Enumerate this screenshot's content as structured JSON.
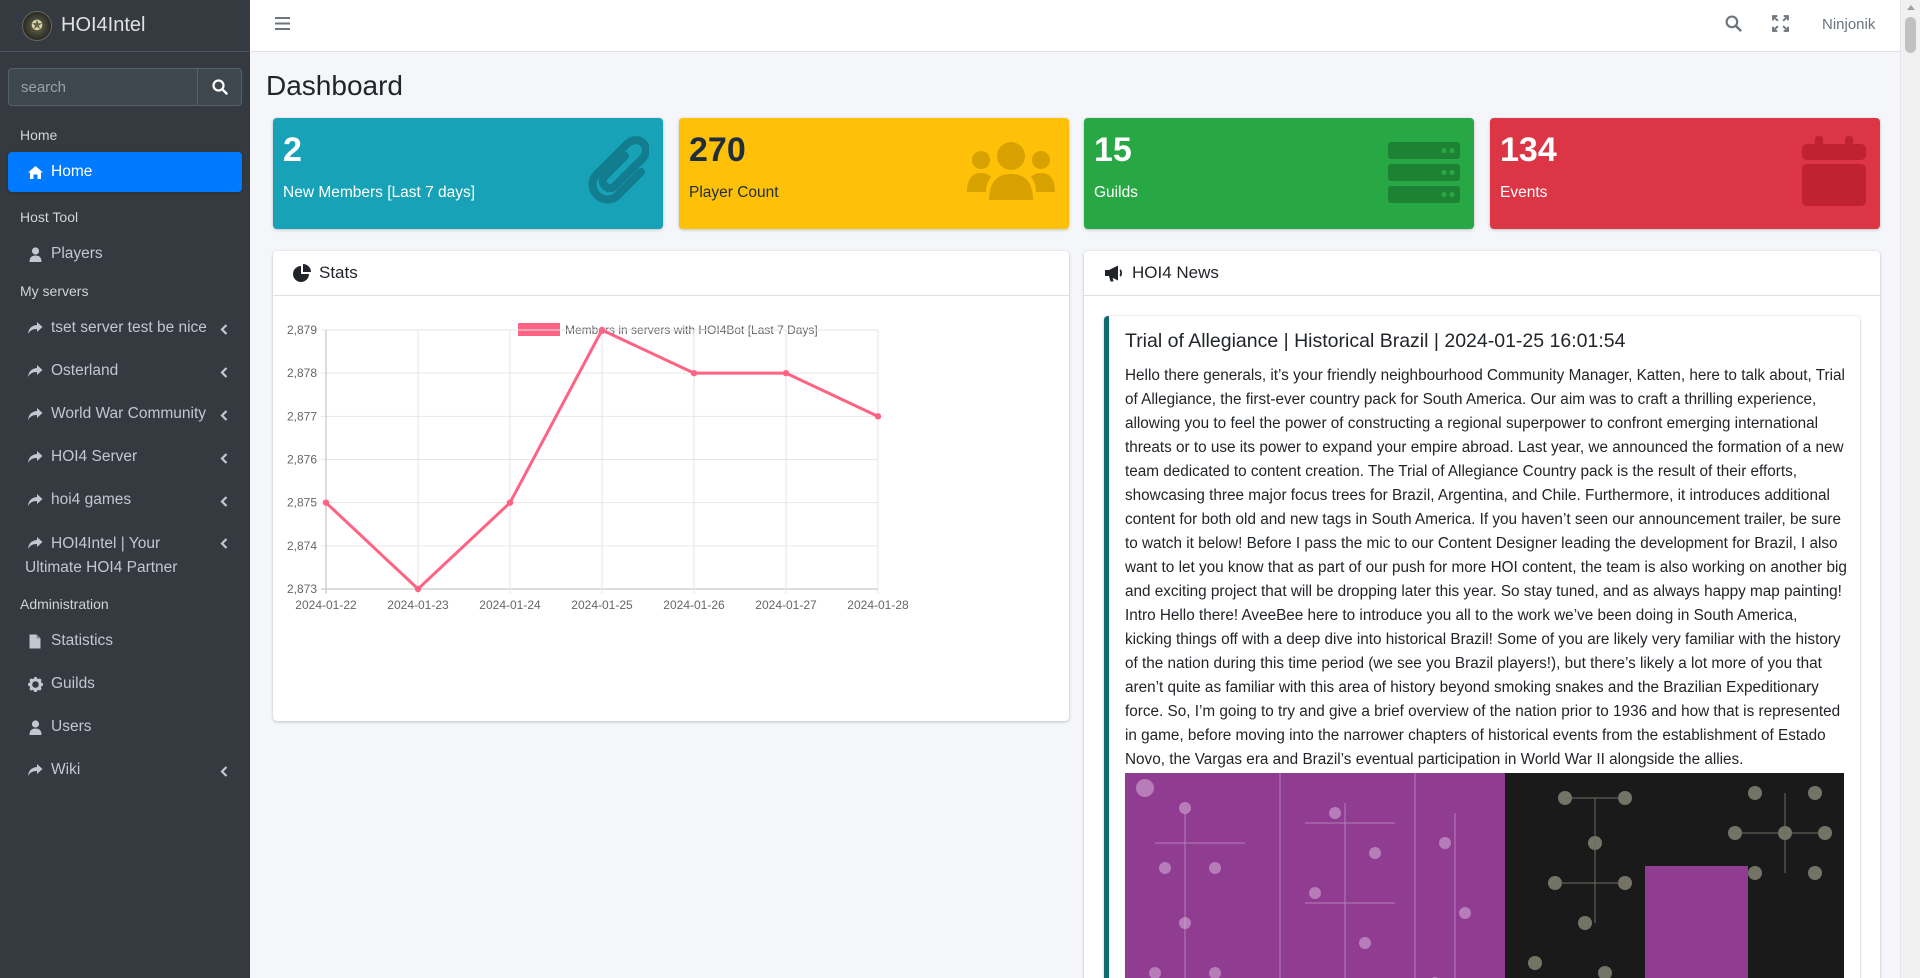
{
  "brand": {
    "name": "HOI4Intel"
  },
  "search": {
    "placeholder": "search"
  },
  "sidebar": {
    "sections": [
      {
        "header": "Home",
        "items": [
          {
            "label": "Home",
            "icon": "home-icon",
            "active": true,
            "expandable": false
          }
        ]
      },
      {
        "header": "Host Tool",
        "items": [
          {
            "label": "Players",
            "icon": "user-icon",
            "active": false,
            "expandable": false
          }
        ]
      },
      {
        "header": "My servers",
        "items": [
          {
            "label": "tset server test be nice",
            "icon": "share-icon",
            "expandable": true
          },
          {
            "label": "Osterland",
            "icon": "share-icon",
            "expandable": true
          },
          {
            "label": "World War Community",
            "icon": "share-icon",
            "expandable": true
          },
          {
            "label": "HOI4 Server",
            "icon": "share-icon",
            "expandable": true
          },
          {
            "label": "hoi4 games",
            "icon": "share-icon",
            "expandable": true
          },
          {
            "label": "HOI4Intel | Your Ultimate HOI4 Partner",
            "icon": "share-icon",
            "expandable": true
          }
        ]
      },
      {
        "header": "Administration",
        "items": [
          {
            "label": "Statistics",
            "icon": "file-icon",
            "expandable": false
          },
          {
            "label": "Guilds",
            "icon": "gear-icon",
            "expandable": false
          },
          {
            "label": "Users",
            "icon": "user-icon",
            "expandable": false
          },
          {
            "label": "Wiki",
            "icon": "share-icon",
            "expandable": true
          }
        ]
      }
    ]
  },
  "topbar": {
    "username": "Ninjonik"
  },
  "page": {
    "title": "Dashboard"
  },
  "info_boxes": [
    {
      "value": "2",
      "label": "New Members [Last 7 days]",
      "color": "#17a2b8",
      "icon": "paperclip-icon"
    },
    {
      "value": "270",
      "label": "Player Count",
      "color": "#ffc107",
      "icon": "users-icon"
    },
    {
      "value": "15",
      "label": "Guilds",
      "color": "#28a745",
      "icon": "server-icon"
    },
    {
      "value": "134",
      "label": "Events",
      "color": "#dc3545",
      "icon": "calendar-icon"
    }
  ],
  "stats_card": {
    "title": "Stats"
  },
  "news_card": {
    "title": "HOI4 News",
    "item": {
      "title": "Trial of Allegiance | Historical Brazil | 2024-01-25 16:01:54",
      "body": "Hello there generals, it’s your friendly neighbourhood Community Manager, Katten, here to talk about, Trial of Allegiance, the first-ever country pack for South America. Our aim was to craft a thrilling experience, allowing you to feel the power of constructing a regional superpower to confront emerging international threats or to use its power to expand your empire abroad. Last year, we announced the formation of a new team dedicated to content creation. The Trial of Allegiance Country pack is the result of their efforts, showcasing three major focus trees for Brazil, Argentina, and Chile. Furthermore, it introduces additional content for both old and new tags in South America. If you haven’t seen our announcement trailer, be sure to watch it below! Before I pass the mic to our Content Designer leading the development for Brazil, I also want to let you know that as part of our push for more HOI content, the team is also working on another big and exciting project that will be dropping later this year. So stay tuned, and as always happy map painting! Intro Hello there! AveeBee here to introduce you all to the work we’ve been doing in South America, kicking things off with a deep dive into historical Brazil! Some of you are likely very familiar with the history of the nation during this time period (we see you Brazil players!), but there’s likely a lot more of you that aren’t quite as familiar with this area of history beyond smoking snakes and the Brazilian Expeditionary force. So, I’m going to try and give a brief overview of the nation prior to 1936 and how that is represented in game, before moving into the narrower chapters of historical events from the establishment of Estado Novo, the Vargas era and Brazil’s eventual participation in World War II alongside the allies."
    }
  },
  "chart_data": {
    "type": "line",
    "legend": "Members in servers with HOI4Bot [Last 7 Days]",
    "color": "#ff6384",
    "x": [
      "2024-01-22",
      "2024-01-23",
      "2024-01-24",
      "2024-01-25",
      "2024-01-26",
      "2024-01-27",
      "2024-01-28"
    ],
    "values": [
      2875,
      2873,
      2875,
      2879,
      2878,
      2878,
      2877
    ],
    "y_ticks": [
      "2,873",
      "2,874",
      "2,875",
      "2,876",
      "2,877",
      "2,878",
      "2,879"
    ],
    "ylim": [
      2873,
      2879
    ],
    "grid": true,
    "legend_position": "top"
  }
}
